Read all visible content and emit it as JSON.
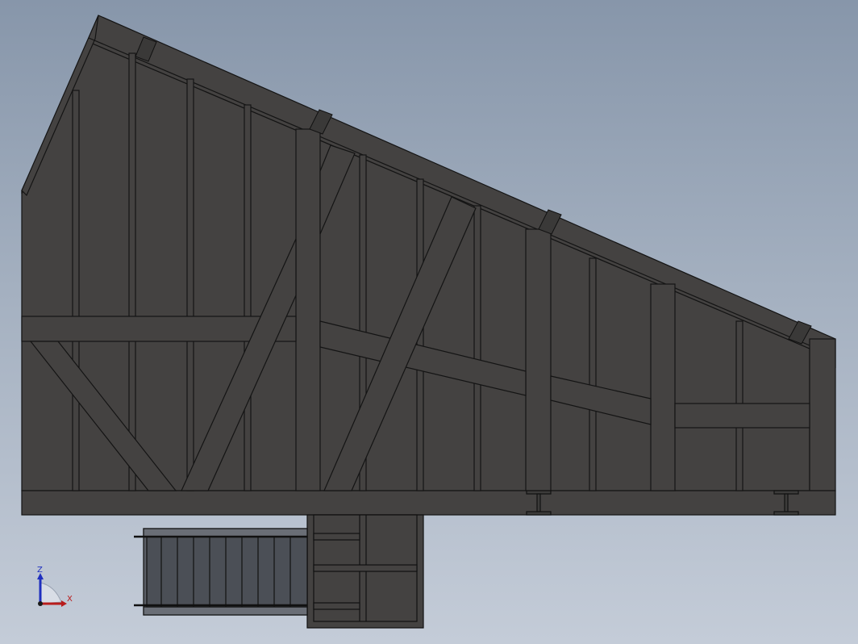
{
  "viewport": {
    "background_top": "#8796aa",
    "background_bottom": "#c4ccd8",
    "model_fill": "#444241",
    "model_edge": "#111111",
    "stair_fill": "#4b4f56"
  },
  "triad": {
    "z_label": "Z",
    "x_label": "X",
    "z_color": "#1f2fbf",
    "x_color": "#b81c1c"
  }
}
